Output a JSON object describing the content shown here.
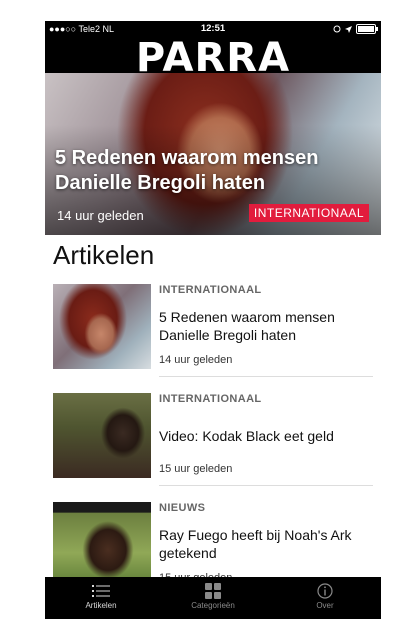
{
  "status_bar": {
    "carrier": "●●●○○ Tele2 NL",
    "time": "12:51"
  },
  "header": {
    "logo": "PARRA"
  },
  "hero": {
    "title": "5 Redenen waarom mensen Danielle Bregoli haten",
    "time": "14 uur geleden",
    "category": "INTERNATIONAAL"
  },
  "section": {
    "title": "Artikelen"
  },
  "articles": [
    {
      "category": "INTERNATIONAAL",
      "title": "5 Redenen waarom mensen Danielle Bregoli haten",
      "time": "14 uur geleden"
    },
    {
      "category": "INTERNATIONAAL",
      "title": "Video: Kodak Black eet geld",
      "time": "15 uur geleden"
    },
    {
      "category": "NIEUWS",
      "title": "Ray Fuego heeft bij Noah's Ark getekend",
      "time": "15 uur geleden"
    }
  ],
  "tabbar": {
    "items": [
      {
        "label": "Artikelen",
        "icon": "list-icon",
        "active": true
      },
      {
        "label": "Categorieën",
        "icon": "grid-icon",
        "active": false
      },
      {
        "label": "Over",
        "icon": "info-icon",
        "active": false
      }
    ]
  },
  "colors": {
    "badge": "#e21c3d",
    "bars": "#000000"
  }
}
